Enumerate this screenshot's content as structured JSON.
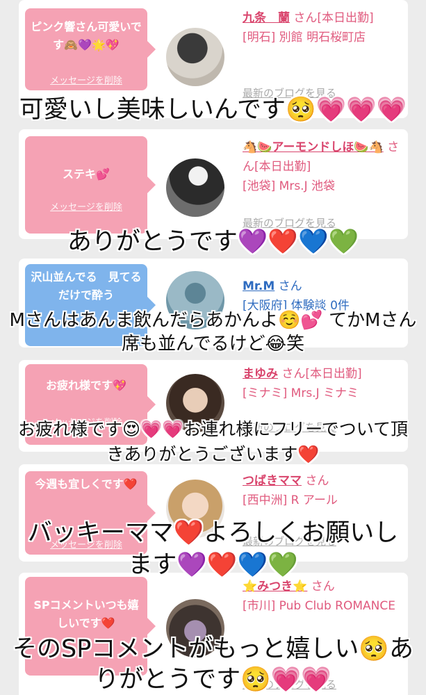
{
  "delete_label": "メッセージを削除",
  "blog_label": "最新のブログを見る",
  "san_label": "さん",
  "cards": [
    {
      "message": "ピンク響さん可愛いです🙈💜🌟💖",
      "name": "九条　蘭",
      "status": "[本日出勤]",
      "location": "[明石] 別館 明石桜町店"
    },
    {
      "message": "ステキ💕",
      "name": "🐴🍉アーモンドしほ🍉🐴",
      "status": "[本日出勤]",
      "location": "[池袋] Mrs.J 池袋"
    },
    {
      "message": "沢山並んでる　見てるだけで酔う",
      "name": "Mr.M",
      "status": "",
      "location": "[大阪府] 体験談 0件"
    },
    {
      "message": "お疲れ様です💖",
      "name": "まゆみ",
      "status": "[本日出勤]",
      "location": "[ミナミ] Mrs.J ミナミ"
    },
    {
      "message": "今週も宜しくです❤️",
      "name": "つばきママ",
      "status": "",
      "location": "[西中洲] R アール"
    },
    {
      "message": "SPコメントいつも嬉しいです❤️",
      "name": "⭐️みつき⭐️",
      "status": "",
      "location": "[市川] Pub Club ROMANCE"
    }
  ],
  "overlays": [
    "可愛いし美味しいんです🥺💗💗💗",
    "ありがとうです💜❤️💙💚",
    "Mさんはあんま飲んだらあかんよ☺️💕 てかMさん席も並んでるけど😂笑",
    "お疲れ様です😍💗💗お連れ様にフリーでついて頂きありがとうございます❤️",
    "バッキーママ❤️よろしくお願いします💜❤️💙💚",
    "そのSPコメントがもっと嬉しい🥺ありがとうです🥺💗💗"
  ],
  "colors": {
    "pink_bubble": "#f5a2b4",
    "blue_bubble": "#7fb4ec",
    "name_pink": "#d9446c",
    "name_blue": "#2f6cc0"
  }
}
